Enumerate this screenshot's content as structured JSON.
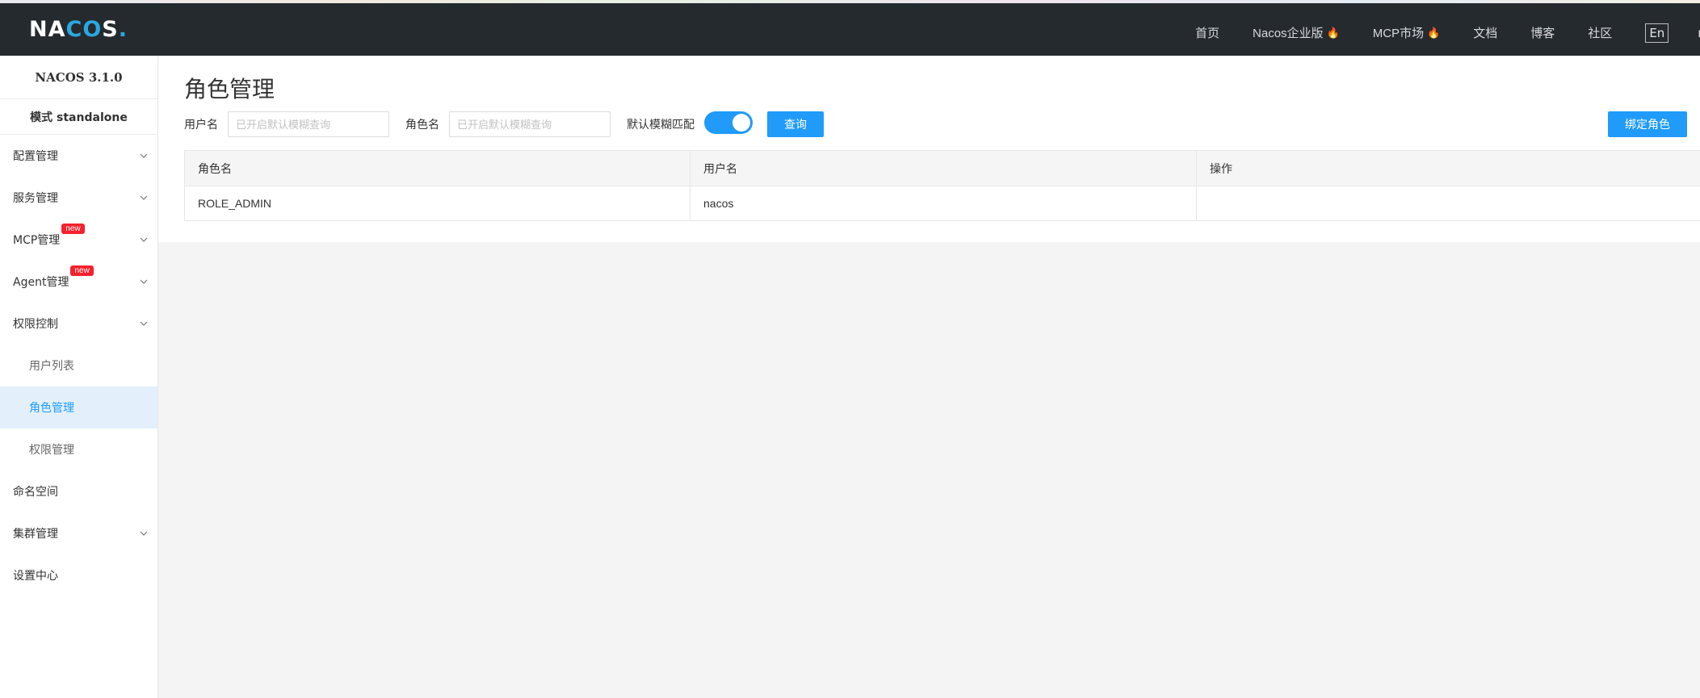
{
  "header": {
    "logo_text_left": "NA",
    "logo_text_ring": "CO",
    "logo_text_right": "S",
    "logo_dot": ".",
    "nav": [
      {
        "label": "首页",
        "hot": false
      },
      {
        "label": "Nacos企业版",
        "hot": true
      },
      {
        "label": "MCP市场",
        "hot": true
      },
      {
        "label": "文档",
        "hot": false
      },
      {
        "label": "博客",
        "hot": false
      },
      {
        "label": "社区",
        "hot": false
      }
    ],
    "lang": "En",
    "user": "nacos"
  },
  "sidebar": {
    "version": "NACOS 3.1.0",
    "mode": "模式 standalone",
    "items": [
      {
        "label": "配置管理",
        "badge": "",
        "expandable": true
      },
      {
        "label": "服务管理",
        "badge": "",
        "expandable": true
      },
      {
        "label": "MCP管理",
        "badge": "new",
        "expandable": true
      },
      {
        "label": "Agent管理",
        "badge": "new",
        "expandable": true
      },
      {
        "label": "权限控制",
        "badge": "",
        "expandable": true
      }
    ],
    "auth_sub_items": [
      {
        "label": "用户列表",
        "active": false
      },
      {
        "label": "角色管理",
        "active": true
      },
      {
        "label": "权限管理",
        "active": false
      }
    ],
    "bottom_items": [
      {
        "label": "命名空间",
        "expandable": false
      },
      {
        "label": "集群管理",
        "expandable": true
      },
      {
        "label": "设置中心",
        "expandable": false
      }
    ]
  },
  "main": {
    "title": "角色管理",
    "filters": {
      "username_label": "用户名",
      "username_placeholder": "已开启默认模糊查询",
      "rolename_label": "角色名",
      "rolename_placeholder": "已开启默认模糊查询",
      "fuzzy_label": "默认模糊匹配",
      "fuzzy_enabled": true,
      "query_button": "查询"
    },
    "bind_role_button": "绑定角色",
    "table": {
      "columns": [
        "角色名",
        "用户名",
        "操作"
      ],
      "rows": [
        {
          "role": "ROLE_ADMIN",
          "user": "nacos",
          "action": ""
        }
      ]
    }
  },
  "colors": {
    "accent": "#209bfa",
    "topbar": "#252a2f",
    "badge": "#f5222d",
    "flame": "#ff4d3a"
  }
}
